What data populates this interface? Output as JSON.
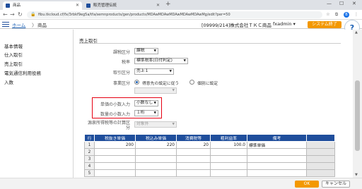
{
  "browser": {
    "tabs": [
      {
        "title": "商品",
        "active": true
      },
      {
        "title": "販売管理伝統",
        "active": false
      }
    ],
    "url": "fibu.tkcloud.cf/fx/3rbkf9eg5a/tfa/semnproducts/gen/products/MDAwMDAwMDAwMDAwMDAwMg/edit?per=50",
    "profile_initial": "B"
  },
  "header": {
    "breadcrumb_home": "ホーム",
    "breadcrumb_sep": "〉",
    "breadcrumb_current": "商品",
    "company": "[09999/214]株式会社ＴＫＣ商品",
    "user": "fxadmin",
    "system_exit": "システム終了",
    "help": "?"
  },
  "sidebar": {
    "items": [
      {
        "label": "基本情報"
      },
      {
        "label": "仕入取引"
      },
      {
        "label": "売上取引"
      },
      {
        "label": "電気通信利用役務"
      },
      {
        "label": "入数"
      }
    ]
  },
  "form": {
    "section_title": "売上取引",
    "fields": {
      "tax_category": {
        "label": "課税区分",
        "value": "課税"
      },
      "tax_rate": {
        "label": "税率",
        "value": "標準税率(日付判定)"
      },
      "transaction_type": {
        "label": "取引区分",
        "value": "売上１"
      },
      "business_type": {
        "label": "事業区分",
        "value": "",
        "radio_client": "得意先の設定に従う",
        "radio_individual": "個別に設定"
      },
      "unit_price_decimals": {
        "label": "単価の小数入力",
        "value": "小数なし"
      },
      "quantity_decimals": {
        "label": "数量の小数入力",
        "value": "１桁"
      },
      "consumption_tax": {
        "label": "源泉所得税等の計算区分",
        "value": "対象外"
      }
    }
  },
  "price_table": {
    "columns": [
      "行",
      "税抜き単価",
      "税込み単価",
      "消費税等",
      "粗利益率",
      "備考"
    ],
    "rows": [
      {
        "row": "1",
        "excl": "200",
        "incl": "220",
        "tax": "20",
        "margin": "100.0",
        "note": "標準単価"
      },
      {
        "row": "2",
        "excl": "",
        "incl": "",
        "tax": "",
        "margin": "",
        "note": ""
      },
      {
        "row": "3",
        "excl": "",
        "incl": "",
        "tax": "",
        "margin": "",
        "note": ""
      },
      {
        "row": "4",
        "excl": "",
        "incl": "",
        "tax": "",
        "margin": "",
        "note": ""
      },
      {
        "row": "5",
        "excl": "",
        "incl": "",
        "tax": "",
        "margin": "",
        "note": ""
      }
    ]
  },
  "footer": {
    "ok": "OK",
    "cancel": "キャンセル"
  },
  "colors": {
    "accent_orange": "#f39800",
    "header_blue": "#1f4e9c",
    "highlight_red": "#e60012"
  }
}
